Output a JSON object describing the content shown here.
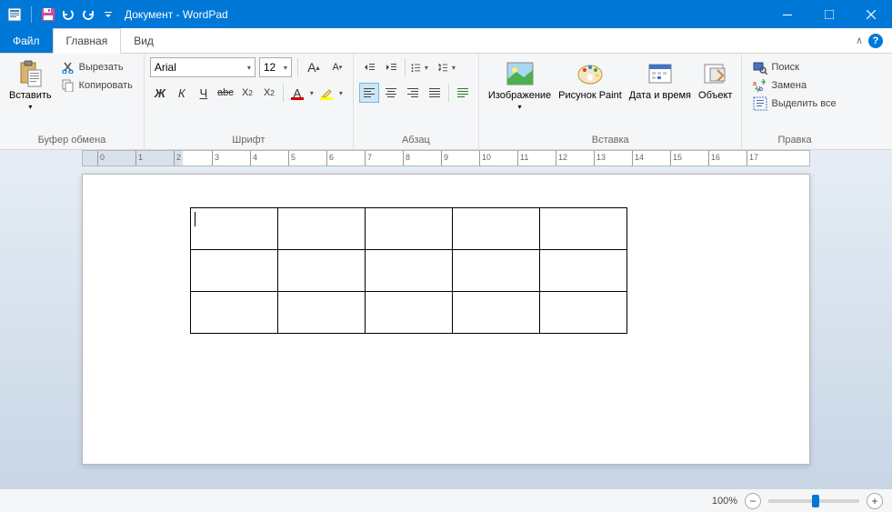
{
  "title": "Документ - WordPad",
  "tabs": {
    "file": "Файл",
    "home": "Главная",
    "view": "Вид"
  },
  "groups": {
    "clipboard": {
      "label": "Буфер обмена",
      "paste": "Вставить",
      "cut": "Вырезать",
      "copy": "Копировать"
    },
    "font": {
      "label": "Шрифт",
      "name": "Arial",
      "size": "12"
    },
    "paragraph": {
      "label": "Абзац"
    },
    "insert": {
      "label": "Вставка",
      "image": "Изображение",
      "paint": "Рисунок Paint",
      "datetime": "Дата и время",
      "object": "Объект"
    },
    "editing": {
      "label": "Правка",
      "find": "Поиск",
      "replace": "Замена",
      "selectall": "Выделить все"
    }
  },
  "ruler": {
    "start": -3,
    "end": 17
  },
  "doc_table": {
    "rows": 3,
    "cols": 5
  },
  "status": {
    "zoom": "100%"
  },
  "colors": {
    "accent": "#0078d7"
  }
}
